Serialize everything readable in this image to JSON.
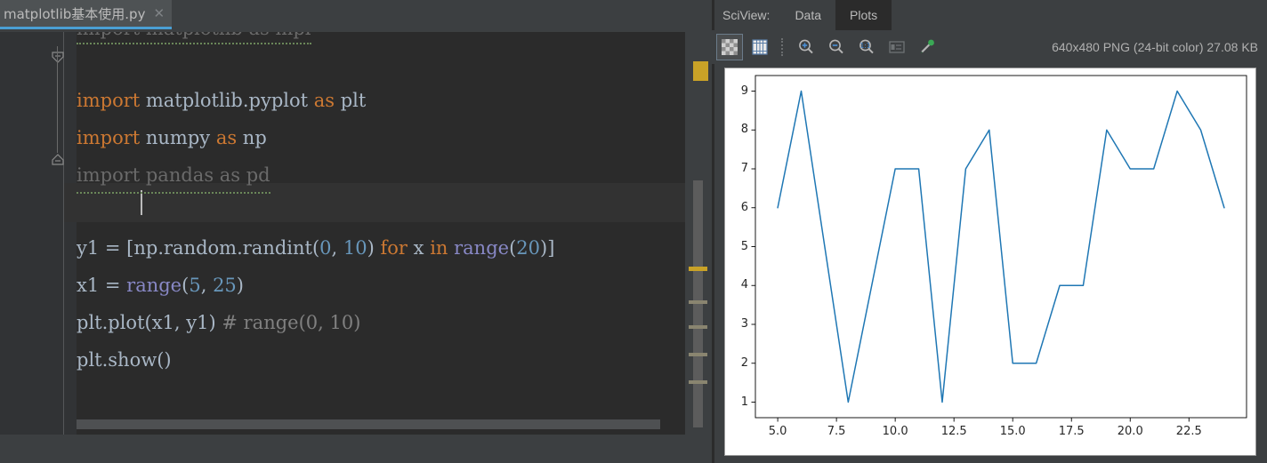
{
  "editor": {
    "tab": {
      "title": "matplotlib基本使用.py",
      "close_icon": "close-icon"
    },
    "clipped_line_text": "import matplotlib as mpl",
    "lines": [
      {
        "segments": [
          {
            "t": "import",
            "c": "kw"
          },
          {
            "t": " matplotlib.pyplot ",
            "c": "id"
          },
          {
            "t": "as",
            "c": "kw"
          },
          {
            "t": " plt",
            "c": "id"
          }
        ]
      },
      {
        "segments": [
          {
            "t": "import",
            "c": "kw"
          },
          {
            "t": " numpy ",
            "c": "id"
          },
          {
            "t": "as",
            "c": "kw"
          },
          {
            "t": " np",
            "c": "id"
          }
        ]
      },
      {
        "segments": [
          {
            "t": "import pandas as pd",
            "c": "dim"
          }
        ]
      },
      {
        "segments": []
      },
      {
        "segments": [
          {
            "t": "y1 = [np.random.randint(",
            "c": "id"
          },
          {
            "t": "0",
            "c": "num"
          },
          {
            "t": ", ",
            "c": "punc"
          },
          {
            "t": "10",
            "c": "num"
          },
          {
            "t": ") ",
            "c": "punc"
          },
          {
            "t": "for",
            "c": "kw"
          },
          {
            "t": " x ",
            "c": "id"
          },
          {
            "t": "in",
            "c": "kw"
          },
          {
            "t": " ",
            "c": "id"
          },
          {
            "t": "range",
            "c": "fn"
          },
          {
            "t": "(",
            "c": "punc"
          },
          {
            "t": "20",
            "c": "num"
          },
          {
            "t": ")]",
            "c": "punc"
          }
        ]
      },
      {
        "segments": [
          {
            "t": "x1 = ",
            "c": "id"
          },
          {
            "t": "range",
            "c": "fn"
          },
          {
            "t": "(",
            "c": "punc"
          },
          {
            "t": "5",
            "c": "num"
          },
          {
            "t": ", ",
            "c": "punc"
          },
          {
            "t": "25",
            "c": "num"
          },
          {
            "t": ")",
            "c": "punc"
          }
        ]
      },
      {
        "segments": [
          {
            "t": "plt.plot(x1, y1) ",
            "c": "id"
          },
          {
            "t": "# range(0, 10)",
            "c": "cmt"
          }
        ]
      },
      {
        "segments": [
          {
            "t": "plt.show()",
            "c": "id"
          }
        ]
      }
    ]
  },
  "sciview": {
    "label": "SciView:",
    "tabs": [
      {
        "label": "Data",
        "active": false
      },
      {
        "label": "Plots",
        "active": true
      }
    ],
    "toolbar": [
      {
        "name": "transparency-grid-icon",
        "title": "Transparency"
      },
      {
        "name": "grid-icon",
        "title": "Grid"
      },
      {
        "name": "zoom-in-icon",
        "title": "Zoom In"
      },
      {
        "name": "zoom-out-icon",
        "title": "Zoom Out"
      },
      {
        "name": "zoom-actual-size-icon",
        "title": "Actual Size"
      },
      {
        "name": "export-icon",
        "title": "Export"
      },
      {
        "name": "color-picker-icon",
        "title": "Color Picker"
      }
    ],
    "image_info": "640x480 PNG (24-bit color) 27.08 KB"
  },
  "chart_data": {
    "type": "line",
    "title": "",
    "xlabel": "",
    "ylabel": "",
    "x": [
      5,
      6,
      7,
      8,
      9,
      10,
      11,
      12,
      13,
      14,
      15,
      16,
      17,
      18,
      19,
      20,
      21,
      22,
      23,
      24
    ],
    "values": [
      6,
      9,
      5,
      1,
      4,
      7,
      7,
      1,
      7,
      8,
      2,
      2,
      4,
      4,
      8,
      7,
      7,
      9,
      8,
      6
    ],
    "series": [
      {
        "name": "y1",
        "color": "#1f77b4",
        "values": [
          6,
          9,
          5,
          1,
          4,
          7,
          7,
          1,
          7,
          8,
          2,
          2,
          4,
          4,
          8,
          7,
          7,
          9,
          8,
          6
        ]
      }
    ],
    "xlim": [
      4.05,
      24.95
    ],
    "ylim": [
      0.6,
      9.4
    ],
    "xticks": [
      "5.0",
      "7.5",
      "10.0",
      "12.5",
      "15.0",
      "17.5",
      "20.0",
      "22.5"
    ],
    "xtick_values": [
      5.0,
      7.5,
      10.0,
      12.5,
      15.0,
      17.5,
      20.0,
      22.5
    ],
    "yticks": [
      "1",
      "2",
      "3",
      "4",
      "5",
      "6",
      "7",
      "8",
      "9"
    ],
    "ytick_values": [
      1,
      2,
      3,
      4,
      5,
      6,
      7,
      8,
      9
    ],
    "grid": false,
    "legend": "none",
    "line_color": "#1f77b4",
    "line_width": 1.5,
    "background": "#ffffff"
  }
}
